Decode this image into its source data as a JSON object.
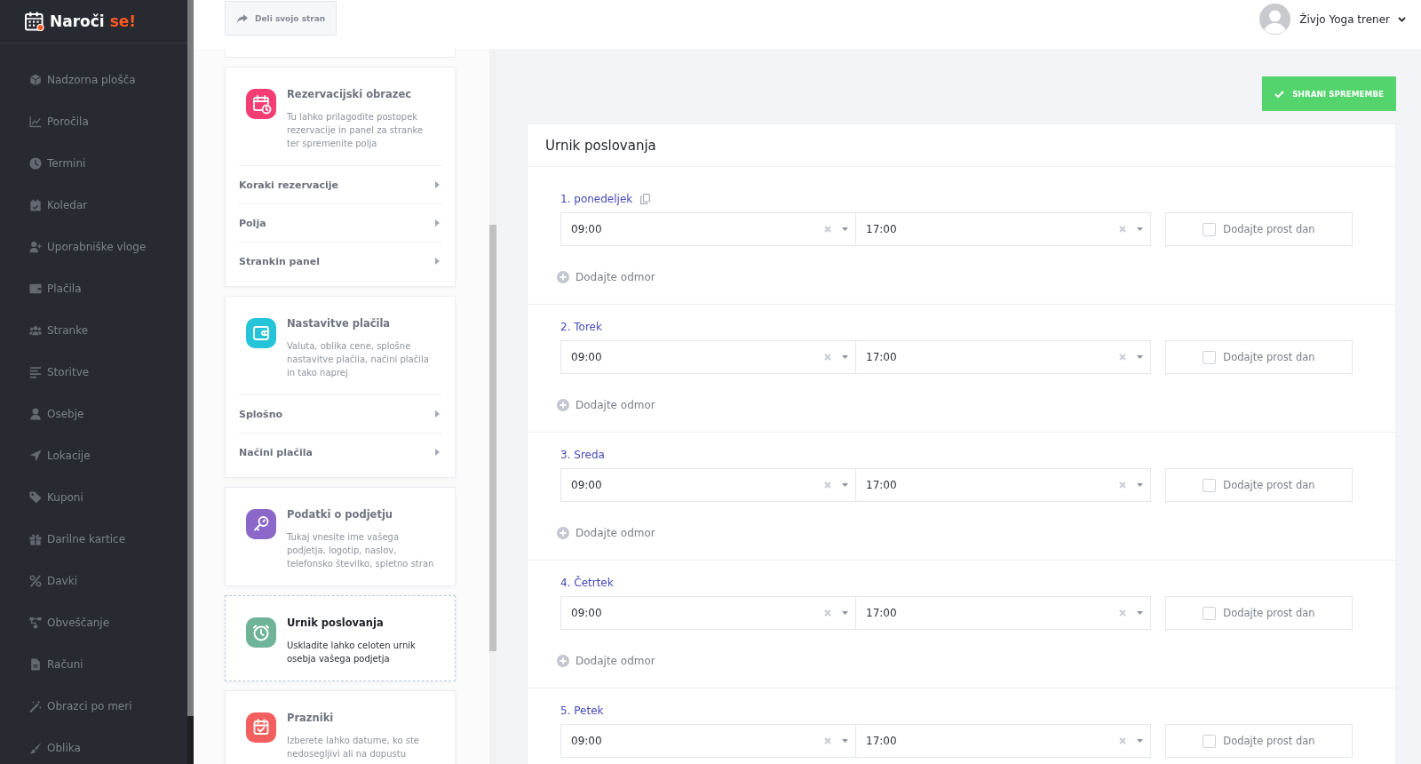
{
  "sidebar": {
    "logo": {
      "name": "Naroči",
      "accent": "se!"
    },
    "items": [
      {
        "label": "Nadzorna plošča",
        "selected": false
      },
      {
        "label": "Poročila",
        "selected": false
      },
      {
        "label": "Termini",
        "selected": false
      },
      {
        "label": "Koledar",
        "selected": false
      },
      {
        "label": "Uporabniške vloge",
        "selected": false
      },
      {
        "label": "Plačila",
        "selected": false
      },
      {
        "label": "Stranke",
        "selected": false
      },
      {
        "label": "Storitve",
        "selected": false
      },
      {
        "label": "Osebje",
        "selected": false
      },
      {
        "label": "Lokacije",
        "selected": false
      },
      {
        "label": "Kuponi",
        "selected": false
      },
      {
        "label": "Darilne kartice",
        "selected": false
      },
      {
        "label": "Davki",
        "selected": false
      },
      {
        "label": "Obveščanje",
        "selected": false
      },
      {
        "label": "Računi",
        "selected": false
      },
      {
        "label": "Obrazci po meri",
        "selected": false
      },
      {
        "label": "Oblika",
        "selected": false
      }
    ]
  },
  "topbar": {
    "share_button": "Deli svojo stran",
    "user_name": "Živjo Yoga trener"
  },
  "settings_cards": [
    {
      "title": "Rezervacijski obrazec",
      "description": "Tu lahko prilagodite postopek rezervacije in panel za stranke ter spremenite polja",
      "color": "#f43d72",
      "selected": false,
      "links": [
        "Koraki rezervacije",
        "Polja",
        "Strankin panel"
      ]
    },
    {
      "title": "Nastavitve plačila",
      "description": "Valuta, oblika cene, splošne nastavitve plačila, načini plačila in tako naprej",
      "color": "#26c4d9",
      "selected": false,
      "links": [
        "Splošno",
        "Načini plačila"
      ]
    },
    {
      "title": "Podatki o podjetju",
      "description": "Tukaj vnesite ime vašega podjetja, logotip, naslov, telefonsko številko, spletno stran",
      "color": "#8b67c9",
      "selected": false
    },
    {
      "title": "Urnik poslovanja",
      "description": "Uskladite lahko celoten urnik osebja vašega podjetja",
      "color": "#6fb499",
      "selected": true
    },
    {
      "title": "Prazniki",
      "description": "Izberete lahko datume, ko ste nedosegljivi ali na dopustu",
      "color": "#f35f5f",
      "selected": false
    }
  ],
  "save_button": "SHRANI SPREMEMBE",
  "schedule": {
    "title": "Urnik poslovanja",
    "days": [
      {
        "label": "1. ponedeljek",
        "copyable": true,
        "start": "09:00",
        "end": "17:00",
        "day_off": {
          "label": "Dodajte prost dan",
          "checked": false
        },
        "add_break": "Dodajte odmor"
      },
      {
        "label": "2. Torek",
        "copyable": false,
        "start": "09:00",
        "end": "17:00",
        "day_off": {
          "label": "Dodajte prost dan",
          "checked": false
        },
        "add_break": "Dodajte odmor"
      },
      {
        "label": "3. Sreda",
        "copyable": false,
        "start": "09:00",
        "end": "17:00",
        "day_off": {
          "label": "Dodajte prost dan",
          "checked": false
        },
        "add_break": "Dodajte odmor"
      },
      {
        "label": "4. Četrtek",
        "copyable": false,
        "start": "09:00",
        "end": "17:00",
        "day_off": {
          "label": "Dodajte prost dan",
          "checked": false
        },
        "add_break": "Dodajte odmor"
      },
      {
        "label": "5. Petek",
        "copyable": false,
        "start": "09:00",
        "end": "17:00",
        "day_off": {
          "label": "Dodajte prost dan",
          "checked": false
        }
      }
    ]
  }
}
